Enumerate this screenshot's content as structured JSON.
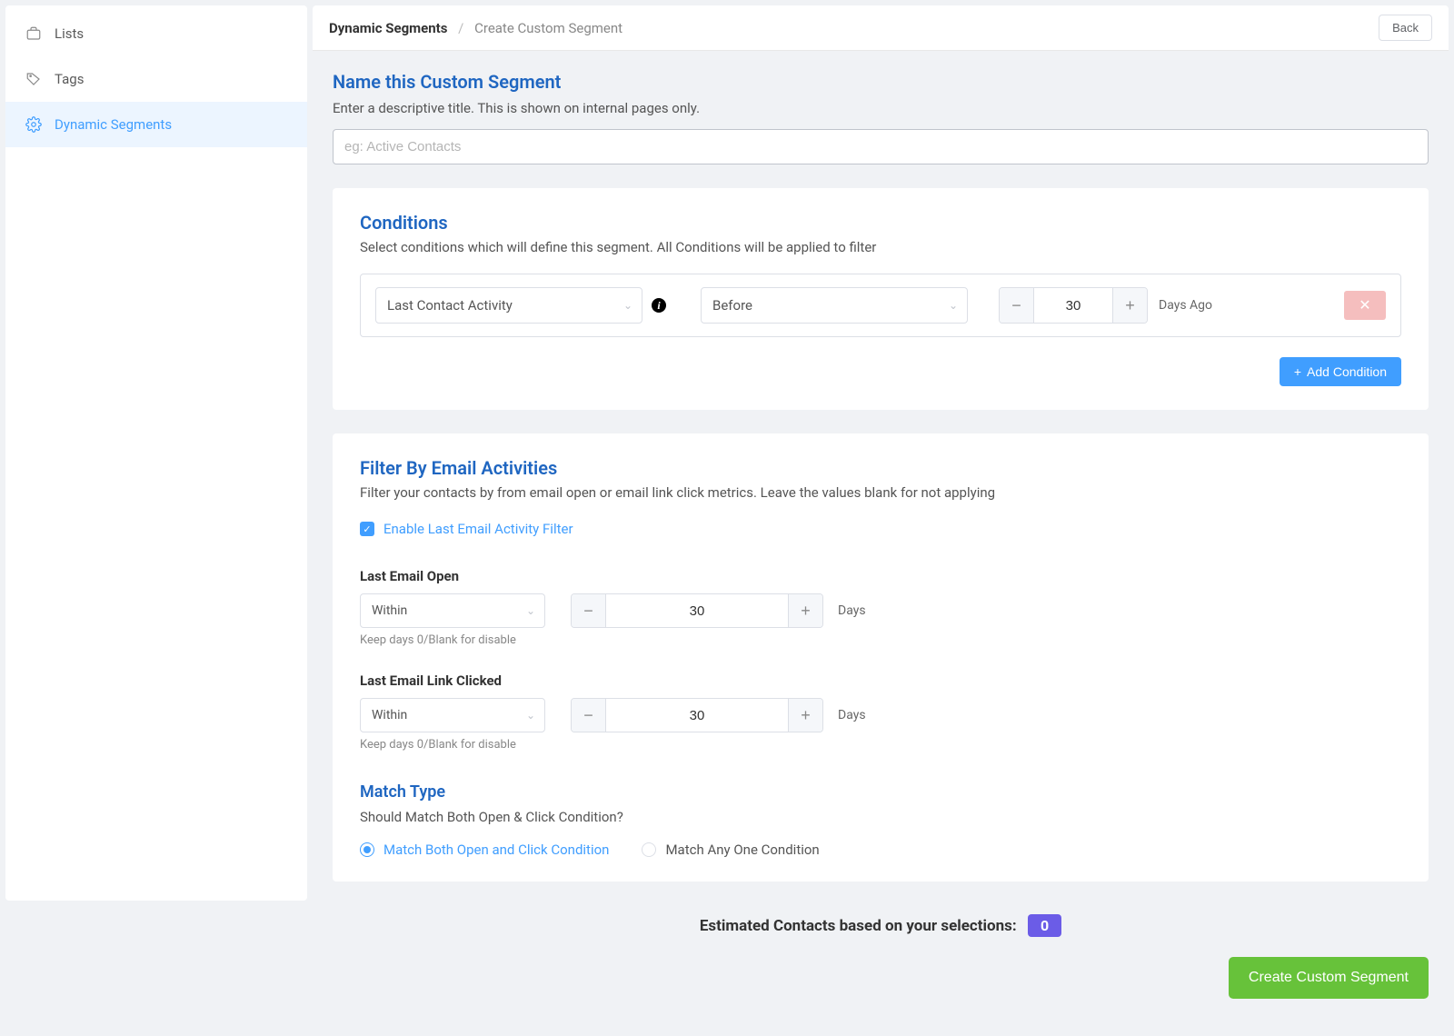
{
  "sidebar": {
    "items": [
      {
        "label": "Lists"
      },
      {
        "label": "Tags"
      },
      {
        "label": "Dynamic Segments"
      }
    ]
  },
  "breadcrumb": {
    "root": "Dynamic Segments",
    "current": "Create Custom Segment"
  },
  "back_label": "Back",
  "name_section": {
    "title": "Name this Custom Segment",
    "desc": "Enter a descriptive title. This is shown on internal pages only.",
    "placeholder": "eg: Active Contacts"
  },
  "conditions": {
    "title": "Conditions",
    "desc": "Select conditions which will define this segment. All Conditions will be applied to filter",
    "field": "Last Contact Activity",
    "operator": "Before",
    "value": "30",
    "unit": "Days Ago",
    "add_label": "Add Condition"
  },
  "email_activities": {
    "title": "Filter By Email Activities",
    "desc": "Filter your contacts by from email open or email link click metrics. Leave the values blank for not applying",
    "enable_label": "Enable Last Email Activity Filter",
    "open": {
      "label": "Last Email Open",
      "operator": "Within",
      "value": "30",
      "unit": "Days",
      "hint": "Keep days 0/Blank for disable"
    },
    "click": {
      "label": "Last Email Link Clicked",
      "operator": "Within",
      "value": "30",
      "unit": "Days",
      "hint": "Keep days 0/Blank for disable"
    }
  },
  "match_type": {
    "title": "Match Type",
    "desc": "Should Match Both Open & Click Condition?",
    "opt_both": "Match Both Open and Click Condition",
    "opt_any": "Match Any One Condition"
  },
  "estimate": {
    "label": "Estimated Contacts based on your selections:",
    "value": "0"
  },
  "create_label": "Create Custom Segment"
}
